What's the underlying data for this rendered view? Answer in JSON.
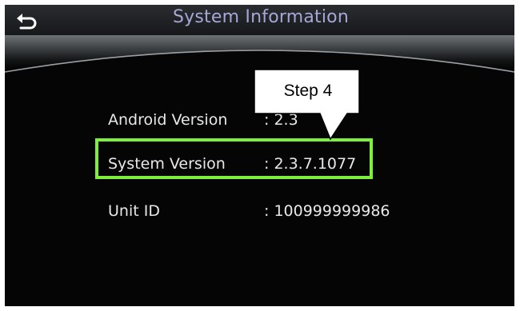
{
  "header": {
    "title": "System Information",
    "back_icon": "back-arrow-icon"
  },
  "rows": [
    {
      "label": "Android Version",
      "value": ": 2.3"
    },
    {
      "label": "System Version",
      "value": ": 2.3.7.1077"
    },
    {
      "label": "Unit ID",
      "value": ": 100999999986"
    }
  ],
  "annotation": {
    "callout_text": "Step 4",
    "highlight_color": "#7cf03a"
  },
  "colors": {
    "title": "#a7a6d6",
    "text": "#e8e8e8",
    "background": "#050505"
  }
}
